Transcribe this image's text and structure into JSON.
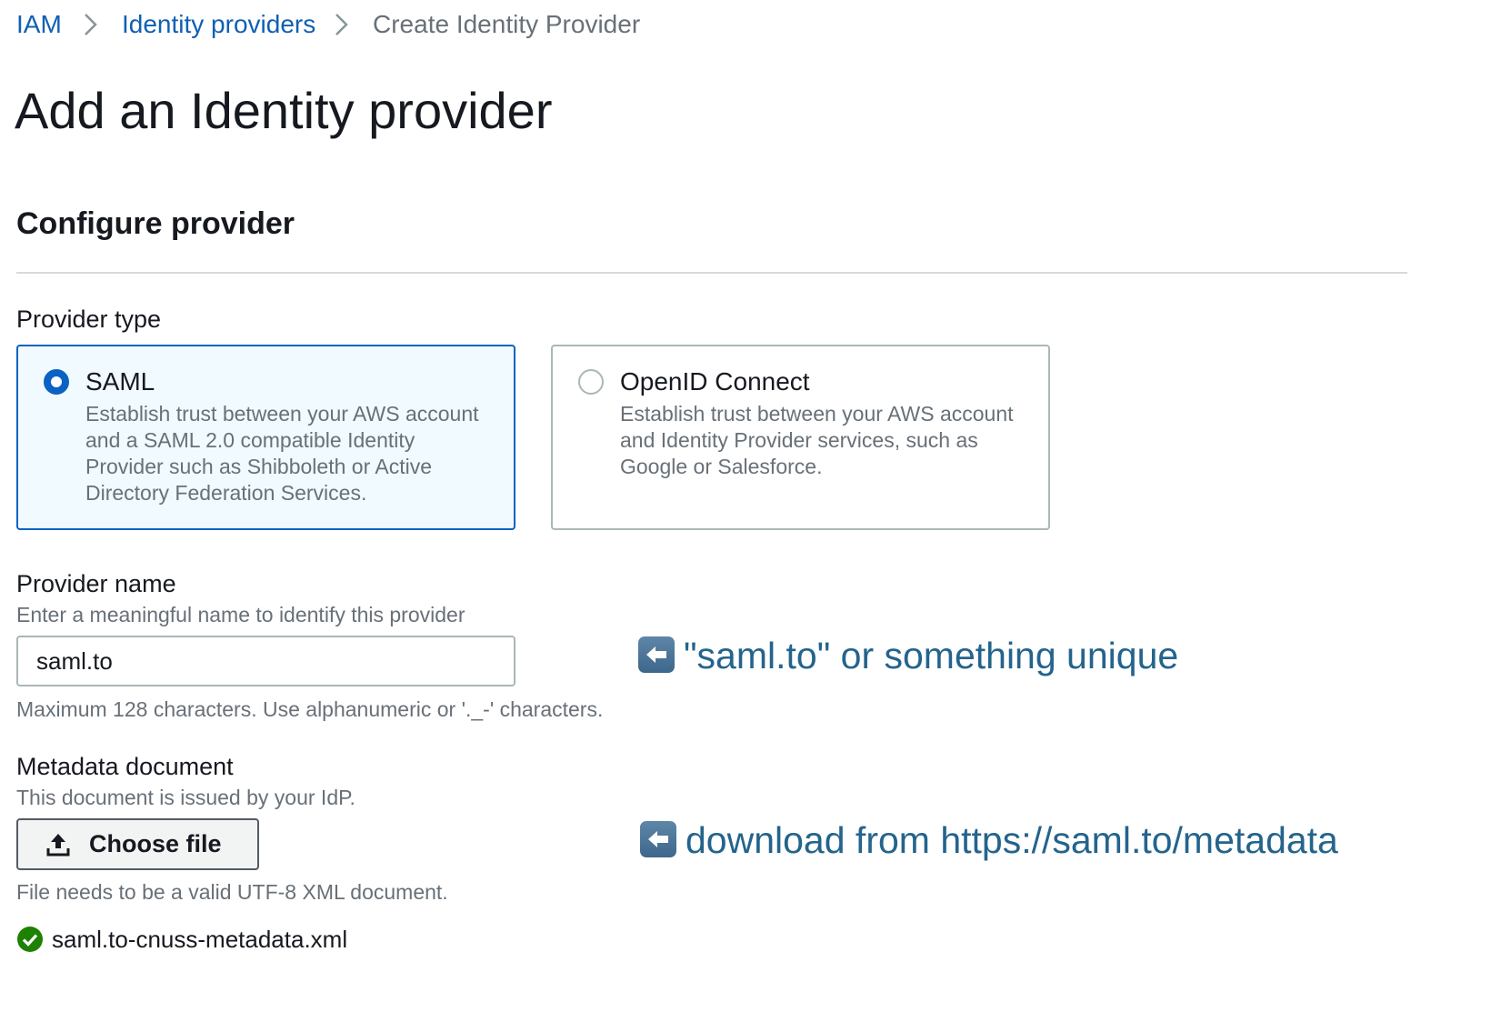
{
  "breadcrumb": {
    "items": [
      "IAM",
      "Identity providers",
      "Create Identity Provider"
    ]
  },
  "page": {
    "title": "Add an Identity provider",
    "section_title": "Configure provider"
  },
  "provider_type": {
    "label": "Provider type",
    "selected": "SAML",
    "options": [
      {
        "title": "SAML",
        "description_lines": [
          "Establish trust between your AWS account",
          "and a SAML 2.0 compatible Identity",
          "Provider such as Shibboleth or Active",
          "Directory Federation Services."
        ]
      },
      {
        "title": "OpenID Connect",
        "description_lines": [
          "Establish trust between your AWS account",
          "and Identity Provider services, such as",
          "Google or Salesforce."
        ]
      }
    ]
  },
  "provider_name": {
    "label": "Provider name",
    "description": "Enter a meaningful name to identify this provider",
    "value": "saml.to",
    "constraint": "Maximum 128 characters. Use alphanumeric or '._-' characters."
  },
  "metadata": {
    "label": "Metadata document",
    "description": "This document is issued by your IdP.",
    "button_label": "Choose file",
    "constraint": "File needs to be a valid UTF-8 XML document.",
    "file_name": "saml.to-cnuss-metadata.xml"
  },
  "annotations": {
    "provider_name_note": "\"saml.to\" or something unique",
    "metadata_note": "download from https://saml.to/metadata"
  },
  "colors": {
    "link": "#0f5fb3",
    "accent": "#0a62c3",
    "success": "#1d8102",
    "annotation": "#24648c"
  },
  "icons": {
    "breadcrumb_separator": "chevron-right-icon",
    "upload": "upload-icon",
    "success": "check-circle-icon",
    "annotation": "left-arrow-icon"
  }
}
